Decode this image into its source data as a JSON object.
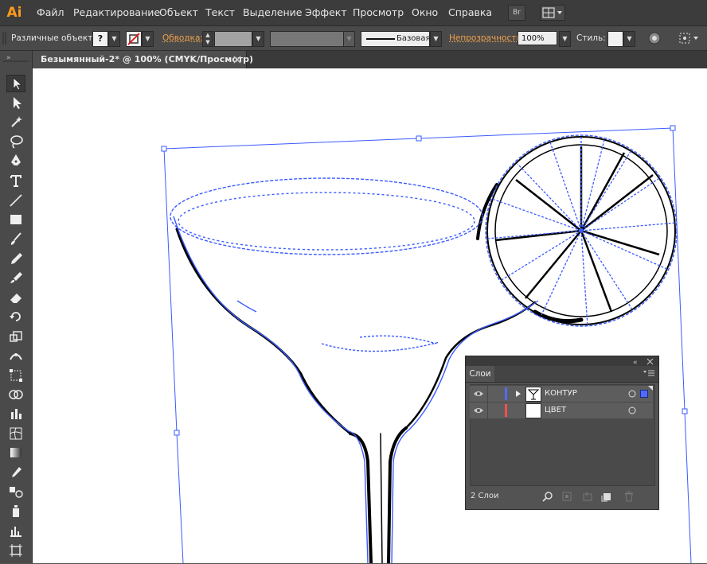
{
  "app": {
    "logo": "Ai",
    "menu": [
      "Файл",
      "Редактирование",
      "Объект",
      "Текст",
      "Выделение",
      "Эффект",
      "Просмотр",
      "Окно",
      "Справка"
    ],
    "bridge_label": "Br"
  },
  "control_bar": {
    "selection_label": "Различные объекты",
    "fill_value": "?",
    "stroke_label": "Обводка:",
    "brush_label": "Базовая",
    "opacity_label": "Непрозрачность:",
    "opacity_value": "100%",
    "style_label": "Стиль:"
  },
  "document": {
    "tab_title": "Безымянный-2* @ 100% (CMYK/Просмотр)"
  },
  "layers_panel": {
    "tab_label": "Слои",
    "layers": [
      {
        "name": "КОНТУР",
        "color": "#4f6cff"
      },
      {
        "name": "ЦВЕТ",
        "color": "#ff4f4f"
      }
    ],
    "count_label": "2 Слои"
  },
  "colors": {
    "selection": "#3b5bff",
    "accent": "#ff9a1e"
  }
}
